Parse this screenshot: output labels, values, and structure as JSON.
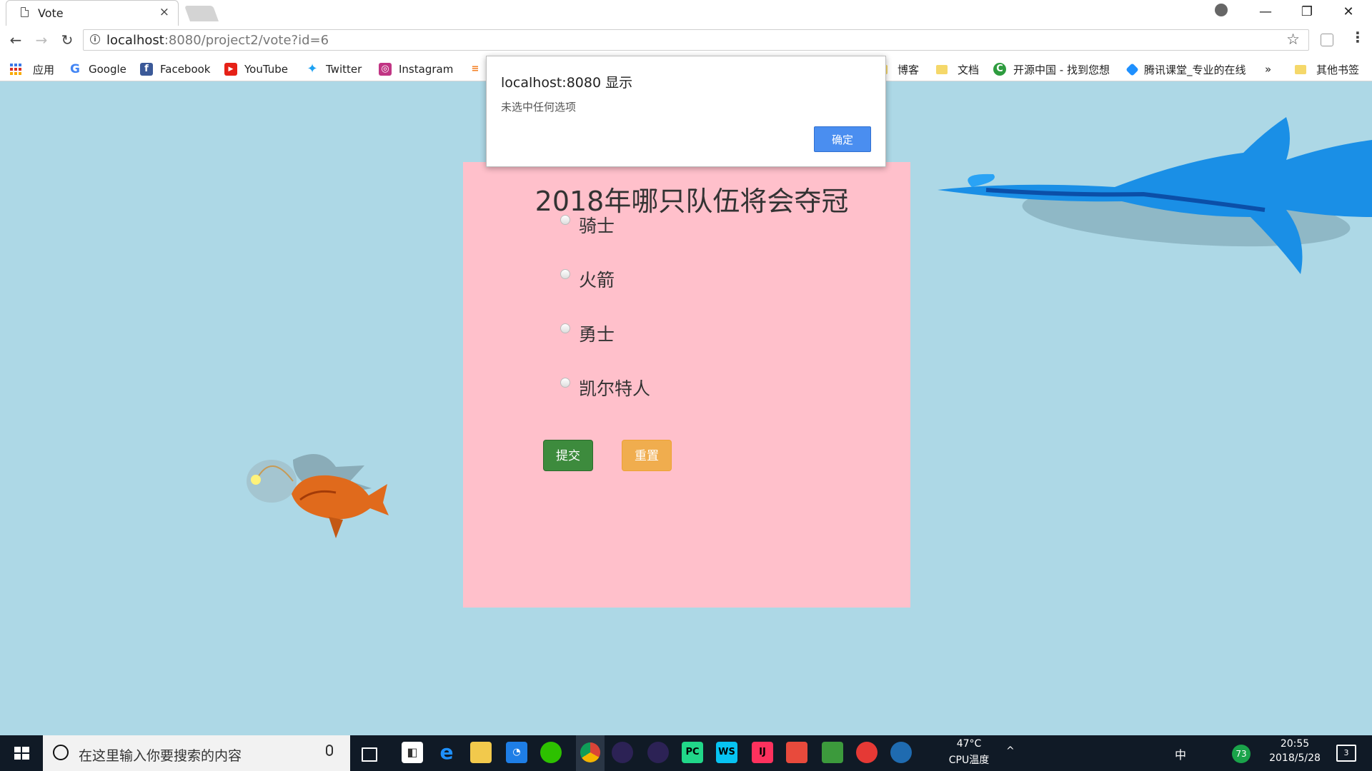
{
  "browser": {
    "tab_title": "Vote",
    "tab_close": "×",
    "url_host": "localhost",
    "url_rest": ":8080/project2/vote?id=6",
    "back": "←",
    "forward": "→",
    "reload": "↻",
    "star": "☆",
    "menu": "⋮",
    "minimize": "—",
    "restore": "❐",
    "close": "✕"
  },
  "bookmarks": {
    "apps": "应用",
    "items": [
      "Google",
      "Facebook",
      "YouTube",
      "Twitter",
      "Instagram",
      "博客",
      "文档",
      "开源中国 - 找到您想",
      "腾讯课堂_专业的在线",
      "其他书签"
    ],
    "overflow": "»"
  },
  "dialog": {
    "title": "localhost:8080 显示",
    "message": "未选中任何选项",
    "ok_label": "确定"
  },
  "vote": {
    "title": "2018年哪只队伍将会夺冠",
    "options": [
      "骑士",
      "火箭",
      "勇士",
      "凯尔特人"
    ],
    "submit_label": "提交",
    "reset_label": "重置"
  },
  "taskbar": {
    "search_placeholder": "在这里输入你要搜索的内容",
    "cpu_temp": "47°C",
    "cpu_label": "CPU温度",
    "ime": "中",
    "badge": "73",
    "time": "20:55",
    "date": "2018/5/28",
    "notification_count": "3"
  },
  "colors": {
    "page_bg": "#add8e6",
    "card_bg": "#ffc0cb",
    "submit": "#3d8b3d",
    "reset": "#f0ad4e",
    "dialog_button": "#4a8ef0"
  }
}
